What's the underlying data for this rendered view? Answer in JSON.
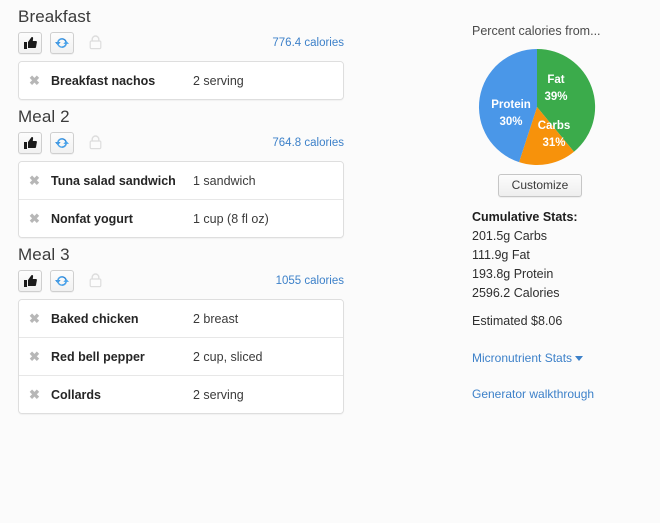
{
  "meals": [
    {
      "title": "Breakfast",
      "like_icon": "thumbs-up-icon",
      "refresh_icon": "refresh-icon",
      "lock_icon": "lock-icon",
      "calories_label": "776.4 calories",
      "remove_glyph": "✖",
      "foods": [
        {
          "name": "Breakfast nachos",
          "amount": "2 serving"
        }
      ]
    },
    {
      "title": "Meal 2",
      "like_icon": "thumbs-up-icon",
      "refresh_icon": "refresh-icon",
      "lock_icon": "lock-icon",
      "calories_label": "764.8 calories",
      "remove_glyph": "✖",
      "foods": [
        {
          "name": "Tuna salad sandwich",
          "amount": "1 sandwich"
        },
        {
          "name": "Nonfat yogurt",
          "amount": "1 cup (8 fl oz)"
        }
      ]
    },
    {
      "title": "Meal 3",
      "like_icon": "thumbs-up-icon",
      "refresh_icon": "refresh-icon",
      "lock_icon": "lock-icon",
      "calories_label": "1055 calories",
      "remove_glyph": "✖",
      "foods": [
        {
          "name": "Baked chicken",
          "amount": "2 breast"
        },
        {
          "name": "Red bell pepper",
          "amount": "2 cup, sliced"
        },
        {
          "name": "Collards",
          "amount": "2 serving"
        }
      ]
    }
  ],
  "stats_panel": {
    "pie_header": "Percent calories from...",
    "customize_label": "Customize",
    "cumulative_title": "Cumulative Stats:",
    "cumulative_lines": [
      "201.5g Carbs",
      "111.9g Fat",
      "193.8g Protein",
      "2596.2 Calories"
    ],
    "estimate_line": "Estimated $8.06",
    "micronutrient_link": "Micronutrient Stats",
    "walkthrough_link": "Generator walkthrough",
    "link_color": "#3d81c9"
  },
  "chart_data": {
    "type": "pie",
    "title": "Percent calories from...",
    "categories": [
      "Fat",
      "Carbs",
      "Protein"
    ],
    "values": [
      39,
      31,
      30
    ],
    "unit": "%",
    "labels": [
      "Fat 39%",
      "Carbs 31%",
      "Protein 30%"
    ],
    "colors": [
      "#3bab4b",
      "#f7920b",
      "#4a97e8"
    ],
    "legend": "none",
    "slice_labels": [
      {
        "name": "Fat",
        "pct": "39%",
        "color": "#3bab4b"
      },
      {
        "name": "Carbs",
        "pct": "31%",
        "color": "#f7920b"
      },
      {
        "name": "Protein",
        "pct": "30%",
        "color": "#4a97e8"
      }
    ]
  }
}
